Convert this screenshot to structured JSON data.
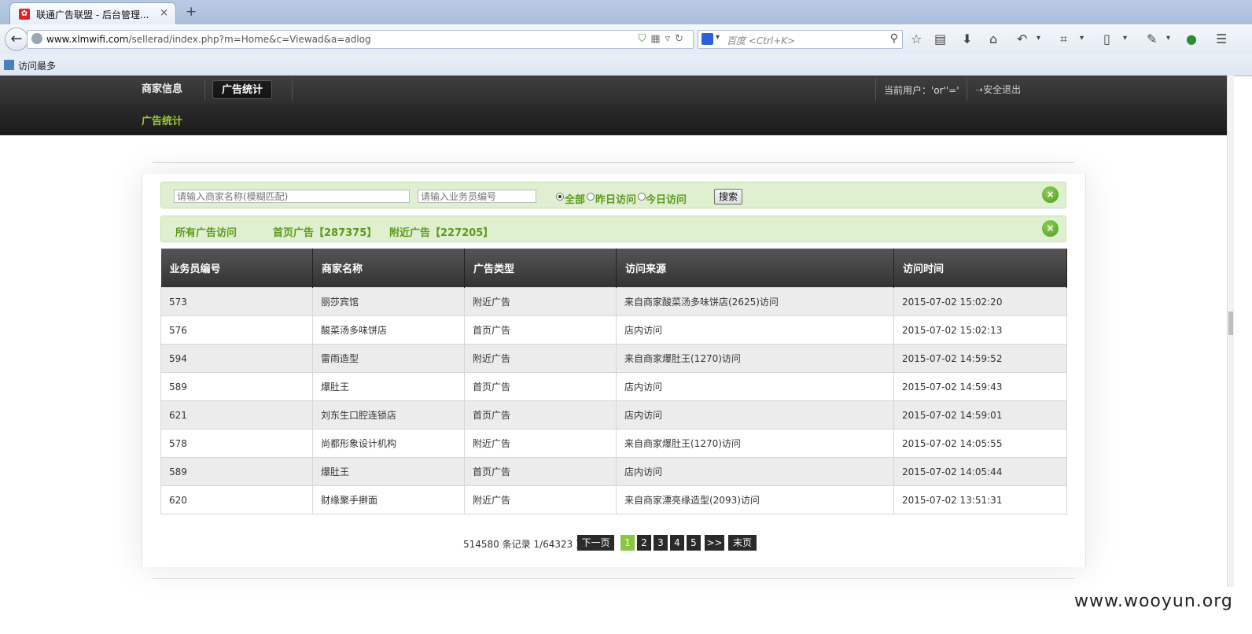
{
  "browser": {
    "tab_title": "联通广告联盟 - 后台管理...",
    "tab_close": "×",
    "new_tab": "+",
    "url_domain": "www.xlmwifi.com",
    "url_path": "/sellerad/index.php?m=Home&c=Viewad&a=adlog",
    "search_placeholder": "百度 <Ctrl+K>",
    "bookmark": "访问最多"
  },
  "header": {
    "nav": [
      "商家信息",
      "广告统计"
    ],
    "current_user": "当前用户：'or''='",
    "logout": "安全退出",
    "sub_nav": "广告统计"
  },
  "search": {
    "merchant_placeholder": "请输入商家名称(模糊匹配)",
    "salesman_placeholder": "请输入业务员编号",
    "radio_all": "全部",
    "radio_yesterday": "昨日访问",
    "radio_today": "今日访问",
    "button": "搜索",
    "close": "×"
  },
  "stats": {
    "all": "所有广告访问",
    "home": "首页广告【287375】",
    "nearby": "附近广告【227205】",
    "close": "×"
  },
  "table": {
    "headers": [
      "业务员编号",
      "商家名称",
      "广告类型",
      "访问来源",
      "访问时间"
    ],
    "rows": [
      [
        "573",
        "丽莎宾馆",
        "附近广告",
        "来自商家酸菜汤多味饼店(2625)访问",
        "2015-07-02 15:02:20"
      ],
      [
        "576",
        "酸菜汤多味饼店",
        "首页广告",
        "店内访问",
        "2015-07-02 15:02:13"
      ],
      [
        "594",
        "雷雨造型",
        "附近广告",
        "来自商家爆肚王(1270)访问",
        "2015-07-02 14:59:52"
      ],
      [
        "589",
        "爆肚王",
        "首页广告",
        "店内访问",
        "2015-07-02 14:59:43"
      ],
      [
        "621",
        "刘东生口腔连锁店",
        "首页广告",
        "店内访问",
        "2015-07-02 14:59:01"
      ],
      [
        "578",
        "尚都形象设计机构",
        "附近广告",
        "来自商家爆肚王(1270)访问",
        "2015-07-02 14:05:55"
      ],
      [
        "589",
        "爆肚王",
        "首页广告",
        "店内访问",
        "2015-07-02 14:05:44"
      ],
      [
        "620",
        "财缘聚手擀面",
        "附近广告",
        "来自商家漂亮缘造型(2093)访问",
        "2015-07-02 13:51:31"
      ]
    ]
  },
  "pager": {
    "info": "514580 条记录 1/64323 页",
    "next": "下一页",
    "pages": [
      "1",
      "2",
      "3",
      "4",
      "5"
    ],
    "current": "1",
    "more": ">>",
    "last": "末页"
  },
  "watermark": "www.wooyun.org",
  "colors": {
    "accent_green": "#8cc63f",
    "label_green": "#5a9a1a",
    "panel_green": "#dff0d0",
    "header_dark": "#333333"
  }
}
